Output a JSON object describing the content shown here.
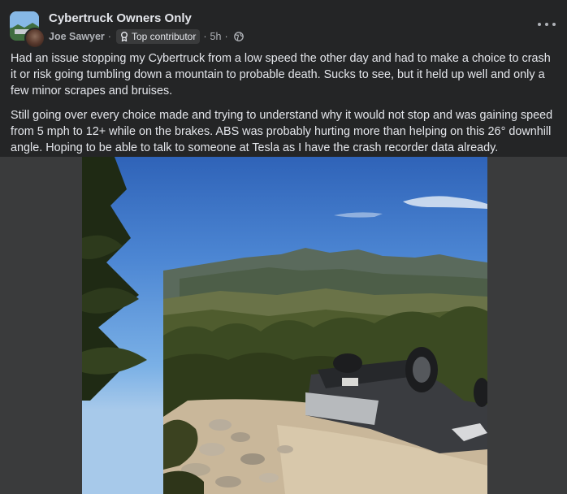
{
  "post": {
    "group_name": "Cybertruck Owners Only",
    "author": "Joe Sawyer",
    "badge": "Top contributor",
    "time": "5h",
    "separator": "·",
    "paragraphs": [
      "Had an issue stopping my Cybertruck from a low speed the other day and had to make a choice to crash it or risk going tumbling down a mountain to probable death. Sucks to see, but it held up well and only a few minor scrapes and bruises.",
      "Still going over every choice made and trying to understand why it would not stop and was gaining speed from 5 mph to 12+ while on the brakes. ABS was probably hurting more than helping on this 26°  downhill angle. Hoping to be able to talk to someone at Tesla as I have the crash recorder data already."
    ]
  },
  "icons": {
    "badge_icon": "badge-icon",
    "audience_icon": "globe-icon",
    "menu_icon": "more-options-icon"
  },
  "colors": {
    "background": "#242526",
    "text_primary": "#e4e6eb",
    "text_secondary": "#b0b3b8",
    "media_background": "#3a3b3c"
  }
}
